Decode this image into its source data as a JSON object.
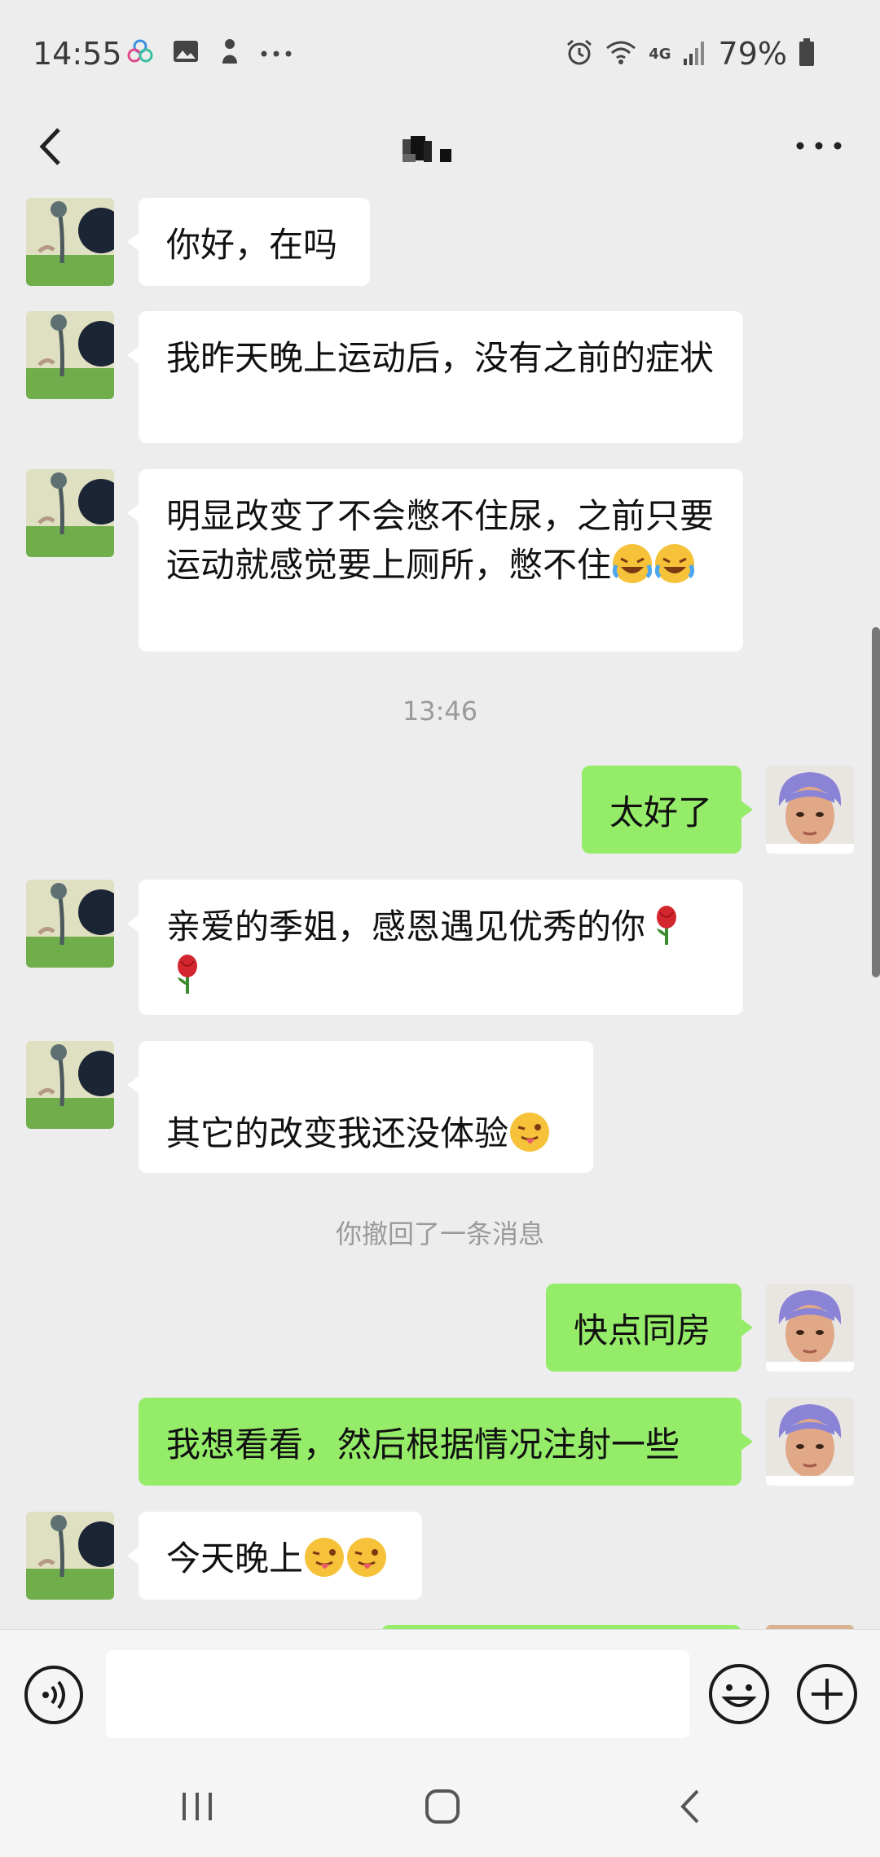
{
  "status_bar": {
    "time": "14:55",
    "network": "4G",
    "battery": "79%",
    "icons": [
      "app-notification-icon",
      "gallery-icon",
      "app-icon",
      "more-dots-icon",
      "alarm-icon",
      "wifi-icon",
      "signal-icon",
      "battery-icon"
    ]
  },
  "header": {
    "back_icon": "chevron-left-icon",
    "more_icon": "more-horizontal-icon"
  },
  "messages": [
    {
      "side": "in",
      "text": "你好，在吗"
    },
    {
      "side": "in",
      "text": "我昨天晚上运动后，没有之前的症状"
    },
    {
      "side": "in",
      "text": "明显改变了不会憋不住尿，之前只要运动就感觉要上厕所，憋不住",
      "emoji": [
        "laughing-crying-emoji",
        "laughing-crying-emoji"
      ]
    },
    {
      "side": "system",
      "text": "13:46"
    },
    {
      "side": "out",
      "text": "太好了"
    },
    {
      "side": "in",
      "text": "亲爱的季姐，感恩遇见优秀的你",
      "emoji": [
        "rose-emoji",
        "rose-emoji"
      ]
    },
    {
      "side": "in",
      "text": "其它的改变我还没体验",
      "emoji": [
        "winking-tongue-emoji"
      ]
    },
    {
      "side": "system",
      "text": "你撤回了一条消息"
    },
    {
      "side": "out",
      "text": "快点同房"
    },
    {
      "side": "out",
      "text": "我想看看，然后根据情况注射一些"
    },
    {
      "side": "in",
      "text": "今天晚上",
      "emoji": [
        "winking-tongue-emoji",
        "winking-tongue-emoji"
      ]
    }
  ],
  "input_bar": {
    "placeholder": "",
    "icons": [
      "voice-icon",
      "emoji-icon",
      "plus-icon"
    ]
  },
  "colors": {
    "background": "#ededed",
    "incoming_bubble": "#ffffff",
    "outgoing_bubble": "#95ec69",
    "system_text": "#9a9a9a"
  }
}
